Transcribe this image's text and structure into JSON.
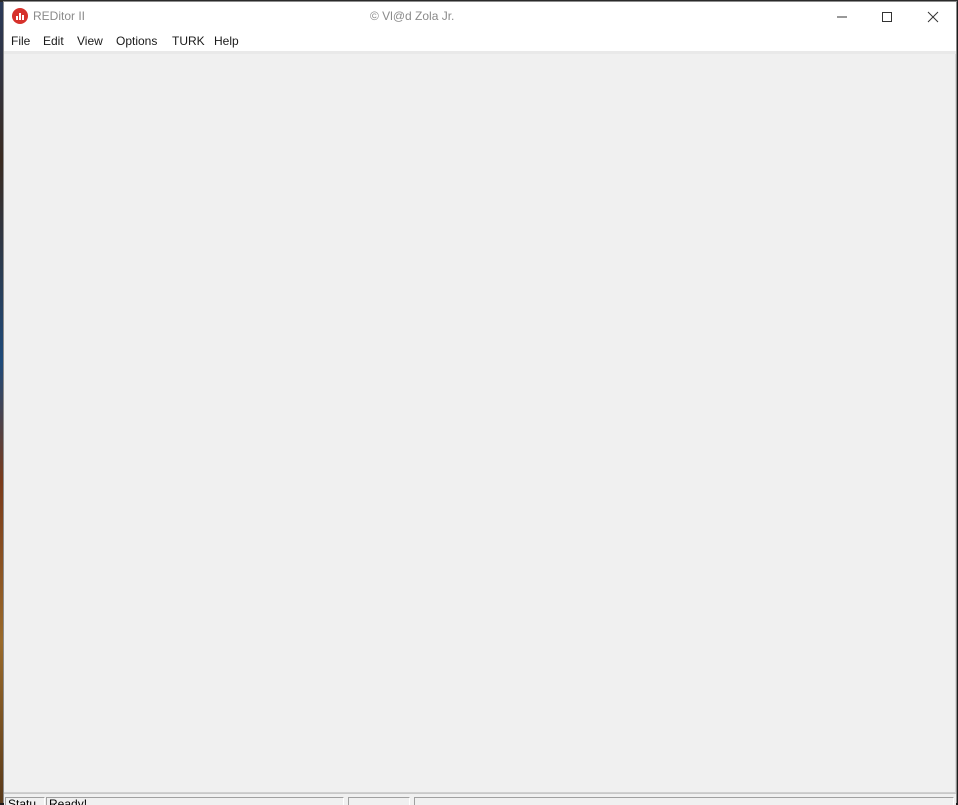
{
  "window": {
    "app_title": "REDitor II",
    "center_title": "© Vl@d Zola Jr.",
    "app_icon": "reditor-logo-icon",
    "controls": {
      "minimize_icon": "minimize-icon",
      "maximize_icon": "maximize-icon",
      "close_icon": "close-icon"
    }
  },
  "menubar": {
    "items": [
      {
        "label": "File"
      },
      {
        "label": "Edit"
      },
      {
        "label": "View"
      },
      {
        "label": "Options"
      },
      {
        "label": "TURK"
      },
      {
        "label": "Help"
      }
    ]
  },
  "statusbar": {
    "panels": [
      "Statu",
      "Ready!",
      "",
      ""
    ]
  },
  "colors": {
    "client_background": "#f0f0f0",
    "icon_red": "#d6312b",
    "title_text": "#8a8a8a"
  }
}
